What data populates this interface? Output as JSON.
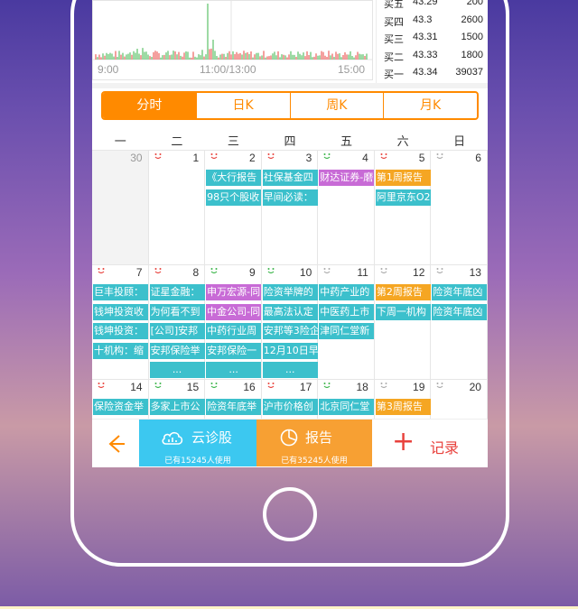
{
  "chart": {
    "x_ticks": [
      "9:00",
      "11:00/13:00",
      "15:00"
    ]
  },
  "orderbook": [
    {
      "label": "买五",
      "price": "43.29",
      "volume": "200"
    },
    {
      "label": "买四",
      "price": "43.3",
      "volume": "2600"
    },
    {
      "label": "买三",
      "price": "43.31",
      "volume": "1500"
    },
    {
      "label": "买二",
      "price": "43.33",
      "volume": "1800"
    },
    {
      "label": "买一",
      "price": "43.34",
      "volume": "39037"
    }
  ],
  "tabs": [
    "分时",
    "日K",
    "周K",
    "月K"
  ],
  "active_tab": "分时",
  "weekdays": [
    "一",
    "二",
    "三",
    "四",
    "五",
    "六",
    "日"
  ],
  "weeks": [
    {
      "days": [
        {
          "n": "30",
          "other_month": true,
          "mood": "",
          "events": []
        },
        {
          "n": "1",
          "mood": "red",
          "events": []
        },
        {
          "n": "2",
          "mood": "red",
          "events": [
            {
              "text": "《大行报告",
              "color": "teal"
            },
            {
              "text": "98只个股收",
              "color": "teal"
            }
          ]
        },
        {
          "n": "3",
          "mood": "red",
          "events": [
            {
              "text": "社保基金四",
              "color": "teal"
            },
            {
              "text": "早间必读：",
              "color": "teal"
            }
          ]
        },
        {
          "n": "4",
          "mood": "green",
          "events": [
            {
              "text": "财达证券-磨",
              "color": "purple"
            }
          ]
        },
        {
          "n": "5",
          "mood": "red",
          "events": [
            {
              "text": "第1周报告",
              "color": "orange"
            },
            {
              "text": "阿里京东O2",
              "color": "teal"
            }
          ]
        },
        {
          "n": "6",
          "mood": "grey",
          "events": []
        }
      ]
    },
    {
      "days": [
        {
          "n": "7",
          "mood": "red",
          "events": [
            {
              "text": "巨丰投顾：",
              "color": "teal"
            },
            {
              "text": "钱坤投资收",
              "color": "teal"
            },
            {
              "text": "钱坤投资：",
              "color": "teal"
            },
            {
              "text": "十机构：缩",
              "color": "teal"
            }
          ]
        },
        {
          "n": "8",
          "mood": "red",
          "events": [
            {
              "text": "证星金融：",
              "color": "teal"
            },
            {
              "text": "为何看不到",
              "color": "teal"
            },
            {
              "text": "[公司]安邦",
              "color": "teal"
            },
            {
              "text": "安邦保险举",
              "color": "teal"
            },
            {
              "text": "...",
              "color": "teal",
              "more": true
            }
          ]
        },
        {
          "n": "9",
          "mood": "green",
          "events": [
            {
              "text": "申万宏源-同",
              "color": "purple"
            },
            {
              "text": "中金公司-同",
              "color": "purple"
            },
            {
              "text": "中药行业周",
              "color": "teal"
            },
            {
              "text": "安邦保险一",
              "color": "teal"
            },
            {
              "text": "...",
              "color": "teal",
              "more": true
            }
          ]
        },
        {
          "n": "10",
          "mood": "green",
          "events": [
            {
              "text": "险资举牌的",
              "color": "teal"
            },
            {
              "text": "最高法认定",
              "color": "teal"
            },
            {
              "text": "安邦等3险企",
              "color": "teal"
            },
            {
              "text": "12月10日早",
              "color": "teal"
            },
            {
              "text": "...",
              "color": "teal",
              "more": true
            }
          ]
        },
        {
          "n": "11",
          "mood": "grey",
          "events": [
            {
              "text": "中药产业的",
              "color": "teal"
            },
            {
              "text": "中医药上市",
              "color": "teal"
            },
            {
              "text": "津同仁堂新",
              "color": "teal"
            }
          ]
        },
        {
          "n": "12",
          "mood": "grey",
          "events": [
            {
              "text": "第2周报告",
              "color": "orange"
            },
            {
              "text": "下周一机构",
              "color": "teal"
            }
          ]
        },
        {
          "n": "13",
          "mood": "grey",
          "events": [
            {
              "text": "险资年底凶",
              "color": "teal"
            },
            {
              "text": "险资年底凶",
              "color": "teal"
            }
          ]
        }
      ]
    },
    {
      "days": [
        {
          "n": "14",
          "mood": "red",
          "events": [
            {
              "text": "保险资金举",
              "color": "teal"
            }
          ]
        },
        {
          "n": "15",
          "mood": "green",
          "events": [
            {
              "text": "多家上市公",
              "color": "teal"
            }
          ]
        },
        {
          "n": "16",
          "mood": "green",
          "events": [
            {
              "text": "险资年底举",
              "color": "teal"
            }
          ]
        },
        {
          "n": "17",
          "mood": "red",
          "events": [
            {
              "text": "沪市价格创",
              "color": "teal"
            }
          ]
        },
        {
          "n": "18",
          "mood": "green",
          "events": [
            {
              "text": "北京同仁堂",
              "color": "teal"
            }
          ]
        },
        {
          "n": "19",
          "mood": "grey",
          "events": [
            {
              "text": "第3周报告",
              "color": "orange"
            }
          ]
        },
        {
          "n": "20",
          "mood": "grey",
          "events": []
        }
      ]
    }
  ],
  "bottom_bar": {
    "cloud_label": "云诊股",
    "cloud_sub": "已有15245人使用",
    "report_label": "报告",
    "report_sub": "已有35245人使用",
    "record_label": "记录"
  },
  "colors": {
    "accent": "#ff8a00",
    "teal": "#3cc0cc",
    "purple": "#c86bd6",
    "orange": "#f5a623",
    "red": "#e8413c"
  }
}
